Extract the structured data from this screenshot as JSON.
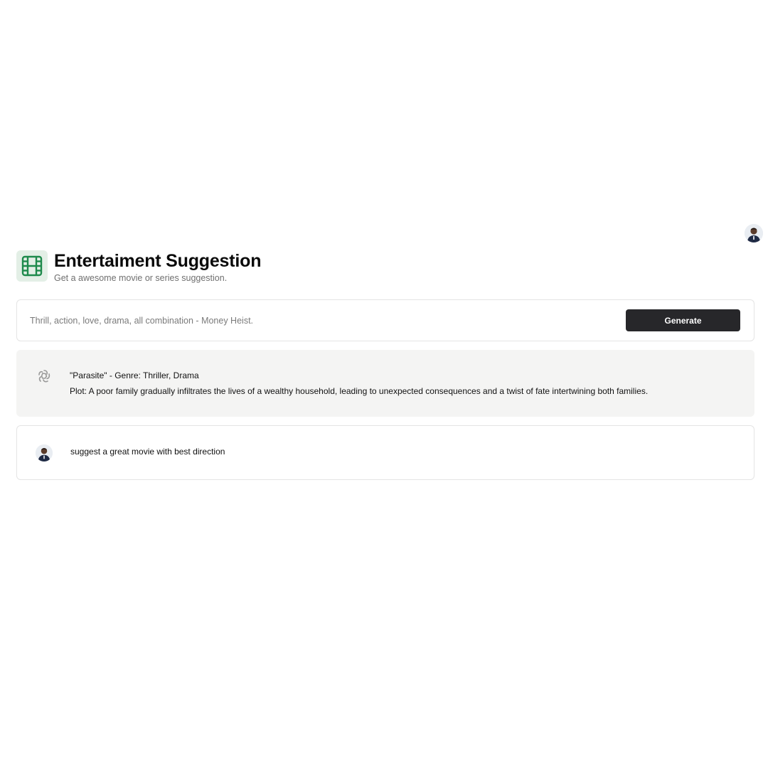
{
  "header": {
    "title": "Entertaiment Suggestion",
    "subtitle": "Get a awesome movie or series suggestion.",
    "icon": "film-icon",
    "icon_color": "#1e8a4c"
  },
  "prompt": {
    "placeholder": "Thrill, action, love, drama, all combination - Money Heist.",
    "value": "",
    "generate_label": "Generate"
  },
  "messages": [
    {
      "role": "ai",
      "avatar": "ai-logo-icon",
      "lines": [
        "\"Parasite\" - Genre: Thriller, Drama",
        "Plot: A poor family gradually infiltrates the lives of a wealthy household, leading to unexpected consequences and a twist of fate intertwining both families."
      ]
    },
    {
      "role": "user",
      "avatar": "user-avatar",
      "lines": [
        "suggest a great movie with best direction"
      ]
    }
  ],
  "colors": {
    "accent": "#1e8a4c",
    "button_bg": "#27272a",
    "ai_message_bg": "#f4f4f3"
  }
}
